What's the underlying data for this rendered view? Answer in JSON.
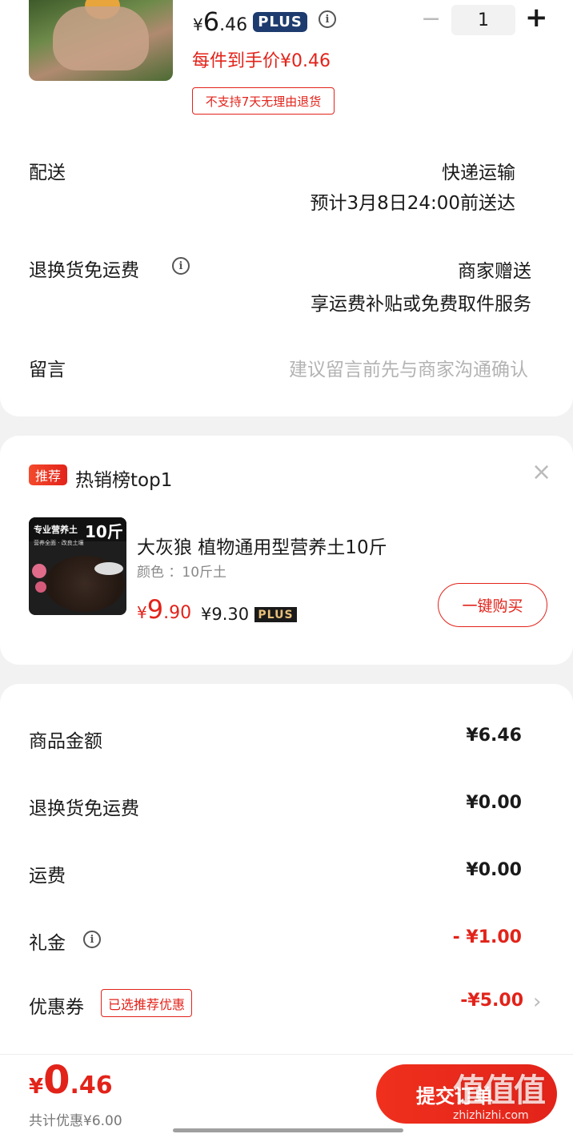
{
  "product": {
    "currency": "¥",
    "price_int": "6",
    "price_dec": ".46",
    "plus_label": "PLUS",
    "per_item_price": "每件到手价¥0.46",
    "return_policy_tag": "不支持7天无理由退货",
    "quantity": "1",
    "minus_symbol": "−",
    "plus_symbol": "+"
  },
  "delivery": {
    "label": "配送",
    "method": "快递运输",
    "eta": "预计3月8日24:00前送达"
  },
  "return_shipping": {
    "label": "退换货免运费",
    "value": "商家赠送",
    "desc": "享运费补贴或免费取件服务"
  },
  "message": {
    "label": "留言",
    "placeholder": "建议留言前先与商家沟通确认"
  },
  "recommend": {
    "badge": "推荐",
    "title": "热销榜top1",
    "close_symbol": "×",
    "product_title": "大灰狼  植物通用型营养土10斤",
    "variant": "颜色 ：10斤土",
    "price_currency": "¥",
    "price_int": "9",
    "price_dec": ".90",
    "plus_price": "¥9.30",
    "plus_label": "PLUS",
    "buy_button": "一键购买",
    "thumb_text_top": "专业营养土",
    "thumb_text_big": "10斤",
    "thumb_text_sub": "营养全面 · 改良土壤"
  },
  "summary": {
    "rows": [
      {
        "label": "商品金额",
        "value": "¥6.46"
      },
      {
        "label": "退换货免运费",
        "value": "¥0.00"
      },
      {
        "label": "运费",
        "value": "¥0.00"
      },
      {
        "label": "礼金",
        "value": "- ¥1.00"
      },
      {
        "label": "优惠券",
        "value": "-¥5.00",
        "tag": "已选推荐优惠"
      }
    ],
    "chevron_symbol": "›"
  },
  "footer": {
    "currency": "¥",
    "total_int": "0",
    "total_dec": ".46",
    "discount_text": "共计优惠¥6.00",
    "submit_label": "提交订单"
  },
  "watermark": {
    "text": "值值值",
    "url": "zhizhizhi.com"
  },
  "colors": {
    "accent_red": "#e2231a",
    "plus_navy": "#1d3b6e",
    "background": "#f2f2f2"
  }
}
